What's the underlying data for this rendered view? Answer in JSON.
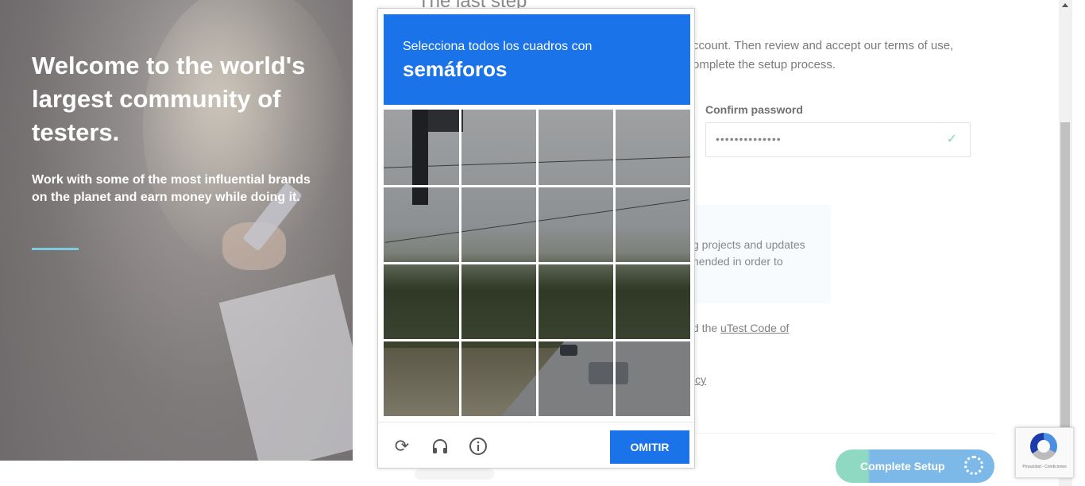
{
  "hero": {
    "title": "Welcome to the world's largest community of testers.",
    "subtitle": "Work with some of the most influential brands on the planet and earn money while doing it."
  },
  "form": {
    "title_partial": "The last step",
    "intro_partial": "ccount. Then review and accept our terms of use, omplete the setup process.",
    "confirm_label": "Confirm password",
    "confirm_value": "••••••••••••••",
    "notice_partial": "g projects and updates nended in order to",
    "code_prefix": "d the ",
    "code_link": "uTest Code of",
    "policy_partial": "icy",
    "complete_button": "Complete Setup"
  },
  "captcha": {
    "prompt_line1": "Selecciona todos los cuadros con",
    "prompt_keyword": "semáforos",
    "skip_button": "OMITIR"
  },
  "recaptcha_badge": {
    "fine_print": "Privacidad - Condiciones"
  },
  "colors": {
    "captcha_blue": "#1a73e8",
    "accent_rule": "#7ccbe0",
    "button_teal": "#8fd9c3",
    "button_blue": "#7db9e8"
  }
}
